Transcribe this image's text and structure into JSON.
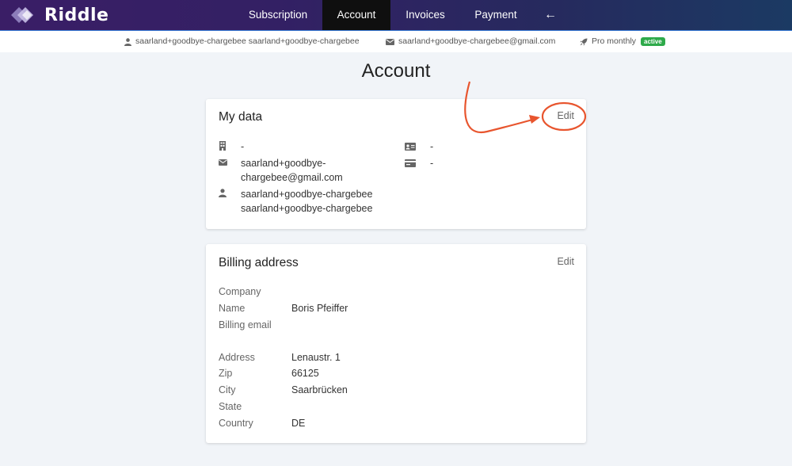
{
  "app": {
    "logo_text": "Riddle"
  },
  "nav": {
    "subscription": "Subscription",
    "account": "Account",
    "invoices": "Invoices",
    "payment": "Payment",
    "back": "←"
  },
  "infobar": {
    "user": "saarland+goodbye-chargebee saarland+goodbye-chargebee",
    "email": "saarland+goodbye-chargebee@gmail.com",
    "plan": "Pro monthly",
    "status": "active"
  },
  "page": {
    "title": "Account"
  },
  "my_data": {
    "title": "My data",
    "edit": "Edit",
    "company": "-",
    "email_line1": "saarland+goodbye-",
    "email_line2": "chargebee@gmail.com",
    "name_line1": "saarland+goodbye-chargebee",
    "name_line2": "saarland+goodbye-chargebee",
    "id_card": "-",
    "vat": "-"
  },
  "billing": {
    "title": "Billing address",
    "edit": "Edit",
    "labels": {
      "company": "Company",
      "name": "Name",
      "billing_email": "Billing email",
      "address": "Address",
      "zip": "Zip",
      "city": "City",
      "state": "State",
      "country": "Country"
    },
    "values": {
      "company": "",
      "name": "Boris Pfeiffer",
      "billing_email": "",
      "address": "Lenaustr. 1",
      "zip": "66125",
      "city": "Saarbrücken",
      "state": "",
      "country": "DE"
    }
  },
  "colors": {
    "accent_annotation": "#e8552e",
    "badge": "#2eaa4a",
    "nav_active": "#0f0f0f"
  }
}
